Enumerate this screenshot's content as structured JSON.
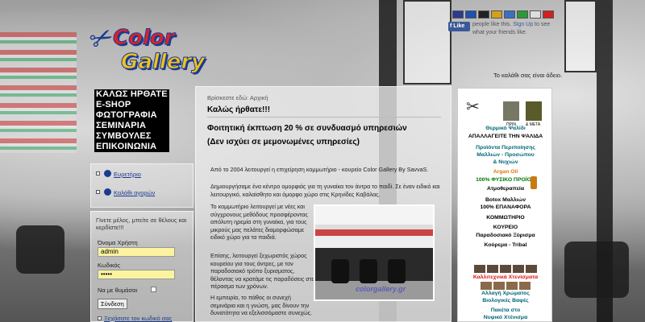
{
  "logo": {
    "line1": "Color",
    "line2": "Gallery"
  },
  "flags": [
    {
      "name": "uk-flag",
      "color": "#2b3b8f"
    },
    {
      "name": "fr-flag",
      "color": "#2050b0"
    },
    {
      "name": "de-flag",
      "color": "#222222"
    },
    {
      "name": "es-flag",
      "color": "#d4a017"
    },
    {
      "name": "gr-flag",
      "color": "#3a70c0"
    },
    {
      "name": "it-flag",
      "color": "#2a9a3a"
    },
    {
      "name": "ru-flag",
      "color": "#dddddd"
    },
    {
      "name": "tr-flag",
      "color": "#d02020"
    }
  ],
  "facebook": {
    "like_label": "Like",
    "text_before": "people like this. ",
    "signup": "Sign Up",
    "text_after": " to see what your friends like."
  },
  "header_right_text": "Το καλάθι σας είναι άδειο.",
  "menu": [
    "ΚΑΛΩΣ ΗΡΘΑΤΕ",
    "E-SHOP",
    "ΦΩΤΟΓΡΑΦΙΑ",
    "ΣΕΜΙΝΑΡΙΑ",
    "ΣΥΜΒΟΥΛΕΣ",
    "ΕΠΙΚΟΙΝΩΝΙΑ"
  ],
  "left_links": {
    "link1": "Ευρετήριο",
    "link2": "Καλάθι αγορών"
  },
  "login": {
    "intro": "Γίνετε μέλος, μπείτε σε θέλους και κερδίστε!!!",
    "username_label": "Όνομα Χρήστη",
    "username_value": "admin",
    "password_label": "Κωδικός",
    "password_value": "•••••",
    "remember_label": "Να με θυμάσαι",
    "submit_label": "Σύνδεση",
    "forgot_label": "Ξεχάσατε τον κωδικό σας"
  },
  "main": {
    "breadcrumb_prefix": "Βρίσκεστε εδώ: ",
    "breadcrumb_current": "Αρχική",
    "title": "Καλώς ήρθατε!!!",
    "promo_line1": "Φοιτητική έκπτωση 20 % σε συνδυασμό υπηρεσιών",
    "promo_line2": "(Δεν ισχύει σε μεμονωμένες υπηρεσίες)",
    "para1": "Από το 2004 λειτουργεί η επιχείρηση κομμωτήριο - κουρείο Color Gallery By SavvaS.",
    "para2": "Δημιουργήσαμε ένα κέντρο ομορφιάς για τη γυναίκα τον άντρα το παιδί. Σε έναν ειδικό και λειτουργικό, καλαίσθητο και όμορφο χώρο στις Κρηνίδες Καβάλας.",
    "para3": "Το κομμωτήριο λειτουργεί με νέες και σύγχρονους μεθόδους προσφέροντας απόλυτη ηρεμία στη γυναίκα, για τους μικρούς μας πελάτες διαμορφώσαμε ειδικό χώρο για τα παιδιά.",
    "para4": "Επίσης, λειτουργεί ξεχωριστός χώρος κουρείου για τους άντρες, με τον παραδοσιακό τρόπο ξυρισματος, θέλοντας να κρατάμε τις παραδόσεις στο πέρασμα των χρόνων.",
    "para5": "Η εμπειρία, το πάθος οι συνεχή σεμινάρια και η γνώση, μας δίνουν την δυνατότητα να εξελισσόμαστε συνεχώς.",
    "photo_watermark": "colorgallery.gr"
  },
  "ad": {
    "before_label": "ΠΡΙΝ",
    "after_label": "& ΜΕΤΑ",
    "lines": [
      {
        "text": "Θερμικό Ψαλίδι",
        "cls": "teal"
      },
      {
        "text": "ΑΠΑΛΛΑΓΕΙΤΕ ΤΗΝ ΨΑΛΙΔΑ",
        "cls": ""
      },
      {
        "text": "Προϊόντα Περιποίησης",
        "cls": "teal"
      },
      {
        "text": "Μαλλιών - Προσώπου",
        "cls": "teal"
      },
      {
        "text": "& Νυχιών",
        "cls": "teal"
      },
      {
        "text": "Argan Oil",
        "cls": "orange"
      },
      {
        "text": "100% ΦΥΣΙΚΟ ΠΡΟΪΟΝ",
        "cls": "green"
      },
      {
        "text": "Ατμοθεραπεία",
        "cls": ""
      },
      {
        "text": "Botox Μαλλιών",
        "cls": ""
      },
      {
        "text": "100% ΕΠΑΝΑΦΟΡΑ",
        "cls": ""
      },
      {
        "text": "ΚΟΜΜΩΤΗΡΙΟ",
        "cls": ""
      },
      {
        "text": "ΚΟΥΡΕΙΟ",
        "cls": ""
      },
      {
        "text": "Παραδοσιακό Ξύρισμα",
        "cls": ""
      },
      {
        "text": "Κούρεμα - Tribal",
        "cls": ""
      },
      {
        "text": "Καλλιτεχνικά Χτενίσματα",
        "cls": "red"
      },
      {
        "text": "Αλλαγή Χρώματος",
        "cls": "teal"
      },
      {
        "text": "Βιολογικές Βαφές",
        "cls": "teal"
      },
      {
        "text": "Πακέτα στο",
        "cls": "teal"
      },
      {
        "text": "Νυφικό Χτένισμα",
        "cls": "teal"
      }
    ]
  }
}
